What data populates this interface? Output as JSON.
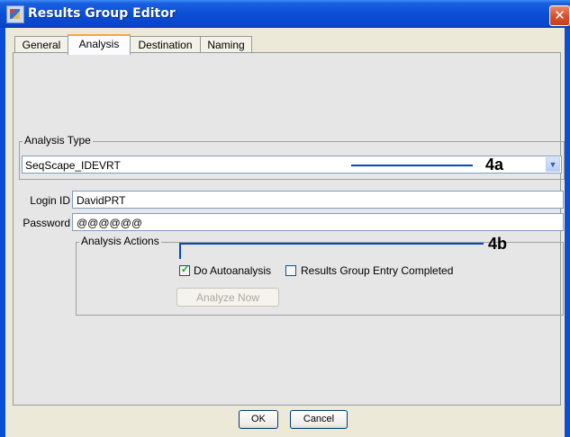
{
  "window": {
    "title": "Results Group Editor",
    "close_glyph": "✕"
  },
  "tabs": [
    {
      "label": "General",
      "active": false
    },
    {
      "label": "Analysis",
      "active": true
    },
    {
      "label": "Destination",
      "active": false
    },
    {
      "label": "Naming",
      "active": false
    }
  ],
  "analysis_type": {
    "legend": "Analysis Type",
    "selected": "SeqScape_IDEVRT",
    "arrow_glyph": "▼"
  },
  "login": {
    "label": "Login ID",
    "value": "DavidPRT"
  },
  "password": {
    "label": "Password",
    "value": "@@@@@@"
  },
  "analysis_actions": {
    "legend": "Analysis Actions",
    "do_autoanalysis": {
      "label": "Do Autoanalysis",
      "checked": true
    },
    "entry_completed": {
      "label": "Results Group Entry Completed",
      "checked": false
    },
    "analyze_now": {
      "label": "Analyze Now",
      "enabled": false
    }
  },
  "footer": {
    "ok_label": "OK",
    "cancel_label": "Cancel"
  },
  "annotations": {
    "a": "4a",
    "b": "4b"
  },
  "colors": {
    "titlebar": "#0a4fd6",
    "active_tab_accent": "#f2a93b",
    "annotation_line": "#0a46c9",
    "check_mark": "#21a121"
  }
}
